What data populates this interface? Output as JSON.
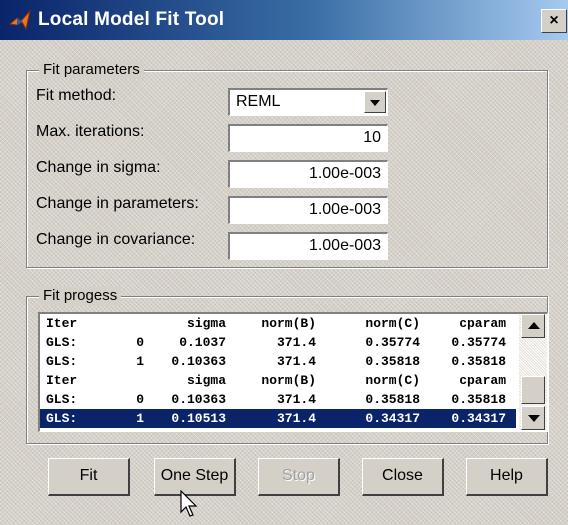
{
  "window": {
    "title": "Local Model Fit Tool",
    "close_label": "×"
  },
  "fit_parameters": {
    "title": "Fit parameters",
    "fit_method": {
      "label": "Fit method:",
      "value": "REML"
    },
    "max_iterations": {
      "label": "Max. iterations:",
      "value": "10"
    },
    "change_sigma": {
      "label": "Change in sigma:",
      "value": "1.00e-003"
    },
    "change_parameters": {
      "label": "Change in parameters:",
      "value": "1.00e-003"
    },
    "change_covariance": {
      "label": "Change in covariance:",
      "value": "1.00e-003"
    }
  },
  "fit_progress": {
    "title": "Fit progess",
    "rows": [
      [
        "Iter",
        "",
        "sigma",
        "norm(B)",
        "norm(C)",
        "cparam"
      ],
      [
        "GLS:",
        "0",
        "0.1037",
        "371.4",
        "0.35774",
        "0.35774"
      ],
      [
        "GLS:",
        "1",
        "0.10363",
        "371.4",
        "0.35818",
        "0.35818"
      ],
      [
        "Iter",
        "",
        "sigma",
        "norm(B)",
        "norm(C)",
        "cparam"
      ],
      [
        "GLS:",
        "0",
        "0.10363",
        "371.4",
        "0.35818",
        "0.35818"
      ],
      [
        "GLS:",
        "1",
        "0.10513",
        "371.4",
        "0.34317",
        "0.34317"
      ]
    ],
    "selected_row": 5
  },
  "buttons": {
    "fit": "Fit",
    "one_step": "One Step",
    "stop": "Stop",
    "close": "Close",
    "help": "Help"
  },
  "colors": {
    "title_bar": "#0a246a",
    "selection": "#0a246a",
    "face": "#d4d0c8"
  }
}
